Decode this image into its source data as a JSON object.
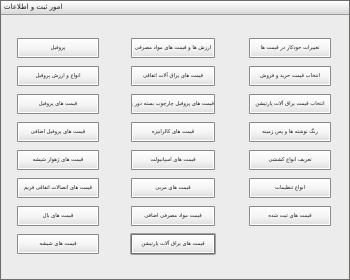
{
  "window": {
    "title": "امور ثبت و اطلاعات"
  },
  "buttons": {
    "col_left": [
      "پروفیل",
      "انواع و ارزش پروفیل",
      "قیمت های پروفیل",
      "قیمت های پروفیل اضافی",
      "قیمت های ژهوار شیشه",
      "قیمت های اتصالات اتفاقی فریم",
      "قیمت های بال",
      "قیمت های شیشه"
    ],
    "col_middle": [
      "ارزش ها و قیمت های مواد مصرفی",
      "قیمت های یراق آلات اتفاقی",
      "قیمت های پروفیل چارچوب بسته دور پنجره",
      "قیمت های کالرانیزه",
      "قیمت های اسپانیولت",
      "قیمت های مربی",
      "قیمت مواد مصرفی اضافی",
      "قیمت های یراق آلات پارتیشن"
    ],
    "col_right": [
      "تغییرات خودکار در قیمت ها",
      "انتخاب قیمت خرید و فروش",
      "انتخاب قیمت یراق آلات پارتیشن",
      "رنگ نوشته ها و پس زمینه",
      "تعریف انواع کششی",
      "انواع تنظیمات",
      "قیمت های ثبت شده"
    ]
  }
}
